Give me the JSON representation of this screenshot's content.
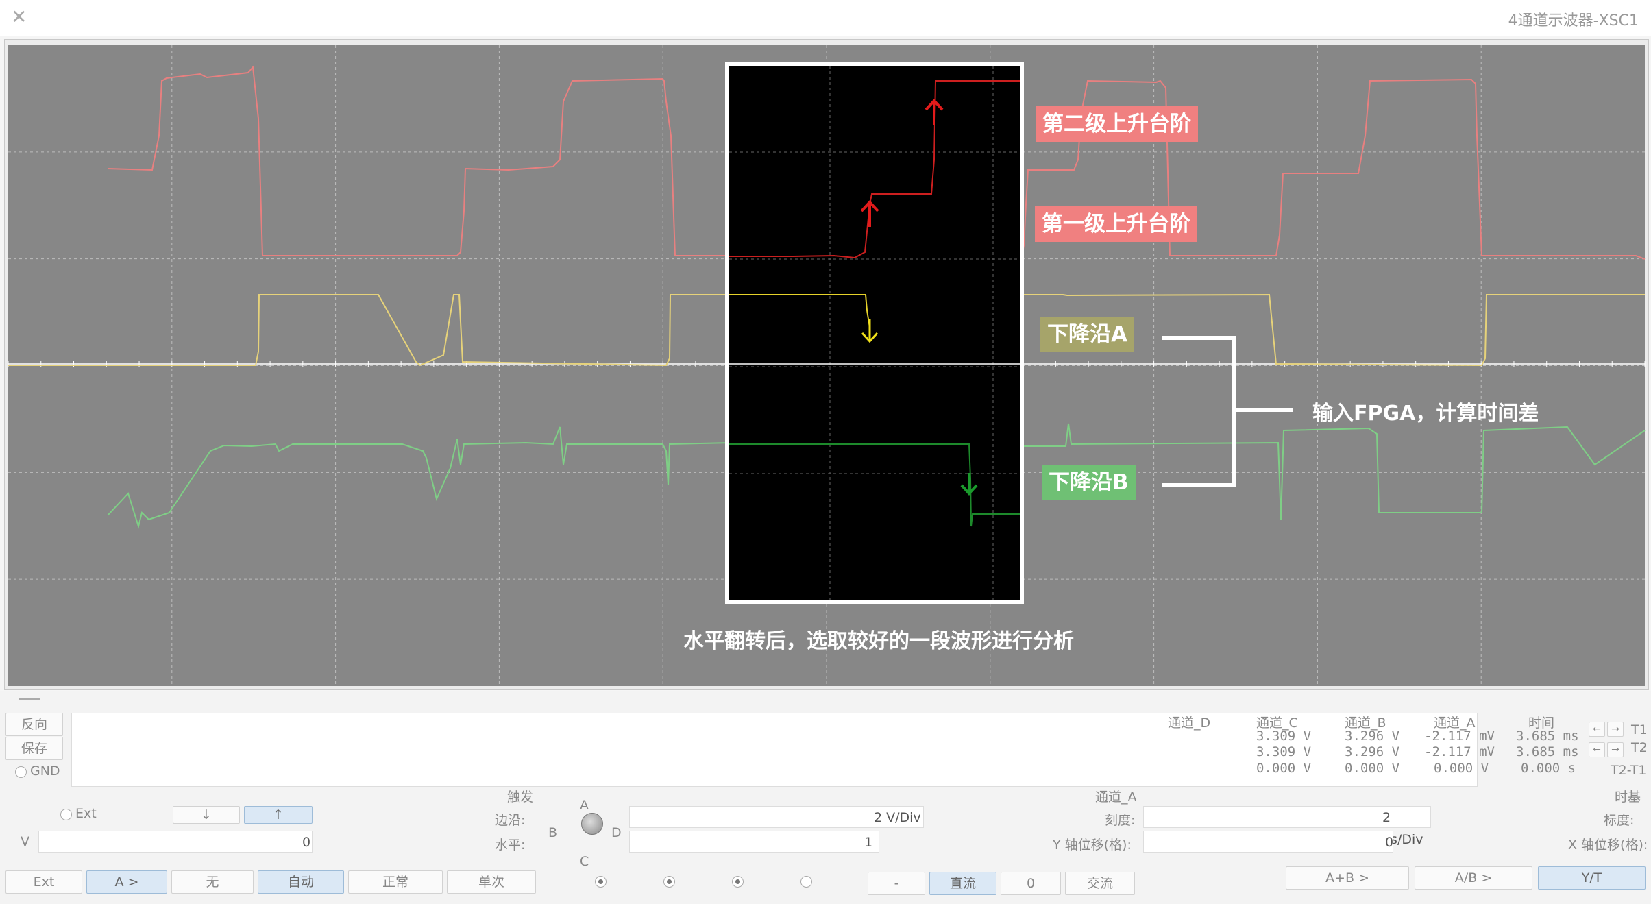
{
  "window": {
    "title": "4通道示波器-XSC1",
    "close_glyph": "✕"
  },
  "annotations": {
    "stage2": "第二级上升台阶",
    "stage1": "第一级上升台阶",
    "edge_a": "下降沿A",
    "edge_b": "下降沿B",
    "fpga": "输入FPGA，计算时间差",
    "caption": "水平翻转后，选取较好的一段波形进行分析"
  },
  "colors": {
    "ch_a": "#e88080",
    "ch_b": "#e6d27a",
    "ch_c": "#7fce86",
    "tag_red": "#f08080",
    "tag_olive": "#a6a46a",
    "tag_green": "#6fc074"
  },
  "readout": {
    "headers": [
      "时间",
      "通道_A",
      "通道_B",
      "通道_C",
      "通道_D"
    ],
    "rows": [
      {
        "label": "T1",
        "time": "3.685 ms",
        "a": "-2.117 mV",
        "b": "3.296 V",
        "c": "3.309 V"
      },
      {
        "label": "T2",
        "time": "3.685 ms",
        "a": "-2.117 mV",
        "b": "3.296 V",
        "c": "3.309 V"
      },
      {
        "label": "T2-T1",
        "time": "0.000 s",
        "a": "0.000 V",
        "b": "0.000 V",
        "c": "0.000 V"
      }
    ],
    "arrows": {
      "left": "←",
      "right": "→"
    },
    "buttons": {
      "reverse": "反向",
      "save": "保存",
      "gnd": "GND"
    }
  },
  "timebase": {
    "title": "时基",
    "scale_label": "标度:",
    "scale_value": "2 us/Div",
    "xpos_label": "X 轴位移(格):",
    "xpos_value": "0",
    "modes": [
      "Y/T",
      "A/B >",
      "A+B >"
    ]
  },
  "channel": {
    "title": "通道_A",
    "scale_label": "刻度:",
    "scale_value": "2 V/Div",
    "ypos_label": "Y 轴位移(格):",
    "ypos_value": "1",
    "coupling": [
      "交流",
      "0",
      "直流",
      "-"
    ],
    "knob_letters": {
      "a": "A",
      "b": "B",
      "c": "C",
      "d": "D"
    }
  },
  "trigger": {
    "title": "触发",
    "edge_label": "边沿:",
    "level_label": "水平:",
    "level_value": "0",
    "level_unit": "V",
    "edge_buttons": [
      "↑",
      "↓"
    ],
    "ext": "Ext",
    "modes": [
      "单次",
      "正常",
      "自动",
      "无",
      "A >",
      "Ext"
    ]
  }
}
